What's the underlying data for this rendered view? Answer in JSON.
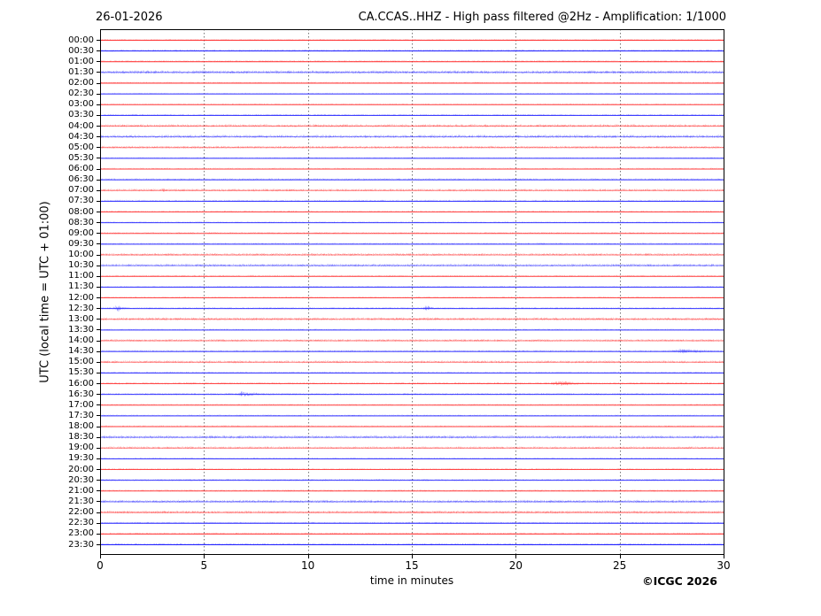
{
  "page": {
    "title_date": "26-01-2026",
    "title_main": "CA.CCAS..HHZ - High pass filtered @2Hz - Amplification: 1/1000",
    "footer": "©ICGC 2026"
  },
  "chart_data": {
    "type": "line",
    "subtype": "helicorder-seismogram",
    "title": "CA.CCAS..HHZ - High pass filtered @2Hz - Amplification: 1/1000",
    "date": "26-01-2026",
    "station": "CA.CCAS..HHZ",
    "filter": "High pass filtered @2Hz",
    "amplification": "1/1000",
    "xlabel": "time in minutes",
    "ylabel": "UTC (local time = UTC + 01:00)",
    "xlim": [
      0,
      30
    ],
    "x_ticks": [
      0,
      5,
      10,
      15,
      20,
      25,
      30
    ],
    "grid_minutes": [
      5,
      10,
      15,
      20,
      25
    ],
    "grid": "vertical-dotted",
    "legend": "none",
    "colors": {
      "red": "#ff1a1a",
      "blue": "#1a1aff",
      "grid": "#777777",
      "axis": "#000000",
      "background": "#ffffff"
    },
    "rows": [
      {
        "label": "00:00",
        "color": "red",
        "amp": 0.8,
        "events": []
      },
      {
        "label": "00:30",
        "color": "blue",
        "amp": 1.1,
        "events": []
      },
      {
        "label": "01:00",
        "color": "red",
        "amp": 0.9,
        "events": []
      },
      {
        "label": "01:30",
        "color": "blue",
        "amp": 1.8,
        "events": []
      },
      {
        "label": "02:00",
        "color": "red",
        "amp": 0.9,
        "events": []
      },
      {
        "label": "02:30",
        "color": "blue",
        "amp": 0.6,
        "events": []
      },
      {
        "label": "03:00",
        "color": "red",
        "amp": 0.7,
        "events": []
      },
      {
        "label": "03:30",
        "color": "blue",
        "amp": 0.9,
        "events": []
      },
      {
        "label": "04:00",
        "color": "red",
        "amp": 1.6,
        "events": []
      },
      {
        "label": "04:30",
        "color": "blue",
        "amp": 1.8,
        "events": []
      },
      {
        "label": "05:00",
        "color": "red",
        "amp": 1.4,
        "events": []
      },
      {
        "label": "05:30",
        "color": "blue",
        "amp": 0.6,
        "events": []
      },
      {
        "label": "06:00",
        "color": "red",
        "amp": 0.8,
        "events": []
      },
      {
        "label": "06:30",
        "color": "blue",
        "amp": 1.1,
        "events": []
      },
      {
        "label": "07:00",
        "color": "red",
        "amp": 1.4,
        "events": [
          {
            "start": 2.85,
            "end": 3.3,
            "amp": 2.2
          }
        ]
      },
      {
        "label": "07:30",
        "color": "blue",
        "amp": 1.0,
        "events": []
      },
      {
        "label": "08:00",
        "color": "red",
        "amp": 0.9,
        "events": []
      },
      {
        "label": "08:30",
        "color": "blue",
        "amp": 0.7,
        "events": []
      },
      {
        "label": "09:00",
        "color": "red",
        "amp": 0.9,
        "events": []
      },
      {
        "label": "09:30",
        "color": "blue",
        "amp": 1.0,
        "events": []
      },
      {
        "label": "10:00",
        "color": "red",
        "amp": 1.5,
        "events": []
      },
      {
        "label": "10:30",
        "color": "blue",
        "amp": 1.6,
        "events": []
      },
      {
        "label": "11:00",
        "color": "red",
        "amp": 0.9,
        "events": []
      },
      {
        "label": "11:30",
        "color": "blue",
        "amp": 0.7,
        "events": []
      },
      {
        "label": "12:00",
        "color": "red",
        "amp": 0.8,
        "events": []
      },
      {
        "label": "12:30",
        "color": "blue",
        "amp": 0.9,
        "events": [
          {
            "start": 0.55,
            "end": 1.4,
            "amp": 3.4
          },
          {
            "start": 15.45,
            "end": 16.2,
            "amp": 2.8
          }
        ]
      },
      {
        "label": "13:00",
        "color": "red",
        "amp": 1.6,
        "events": []
      },
      {
        "label": "13:30",
        "color": "blue",
        "amp": 0.8,
        "events": []
      },
      {
        "label": "14:00",
        "color": "red",
        "amp": 1.3,
        "events": []
      },
      {
        "label": "14:30",
        "color": "blue",
        "amp": 1.0,
        "events": [
          {
            "start": 27.2,
            "end": 30.0,
            "amp": 1.8
          }
        ]
      },
      {
        "label": "15:00",
        "color": "red",
        "amp": 1.4,
        "events": []
      },
      {
        "label": "15:30",
        "color": "blue",
        "amp": 0.9,
        "events": []
      },
      {
        "label": "16:00",
        "color": "red",
        "amp": 1.1,
        "events": [
          {
            "start": 21.5,
            "end": 23.5,
            "amp": 2.1
          }
        ]
      },
      {
        "label": "16:30",
        "color": "blue",
        "amp": 1.0,
        "events": [
          {
            "start": 6.4,
            "end": 8.0,
            "amp": 2.5
          }
        ]
      },
      {
        "label": "17:00",
        "color": "red",
        "amp": 0.9,
        "events": []
      },
      {
        "label": "17:30",
        "color": "blue",
        "amp": 0.8,
        "events": []
      },
      {
        "label": "18:00",
        "color": "red",
        "amp": 0.9,
        "events": []
      },
      {
        "label": "18:30",
        "color": "blue",
        "amp": 1.7,
        "events": []
      },
      {
        "label": "19:00",
        "color": "red",
        "amp": 1.3,
        "events": []
      },
      {
        "label": "19:30",
        "color": "blue",
        "amp": 0.8,
        "events": []
      },
      {
        "label": "20:00",
        "color": "red",
        "amp": 0.9,
        "events": []
      },
      {
        "label": "20:30",
        "color": "blue",
        "amp": 1.0,
        "events": []
      },
      {
        "label": "21:00",
        "color": "red",
        "amp": 1.0,
        "events": []
      },
      {
        "label": "21:30",
        "color": "blue",
        "amp": 1.6,
        "events": []
      },
      {
        "label": "22:00",
        "color": "red",
        "amp": 1.5,
        "events": []
      },
      {
        "label": "22:30",
        "color": "blue",
        "amp": 0.9,
        "events": []
      },
      {
        "label": "23:00",
        "color": "red",
        "amp": 0.9,
        "events": []
      },
      {
        "label": "23:30",
        "color": "blue",
        "amp": 1.1,
        "events": []
      }
    ]
  }
}
